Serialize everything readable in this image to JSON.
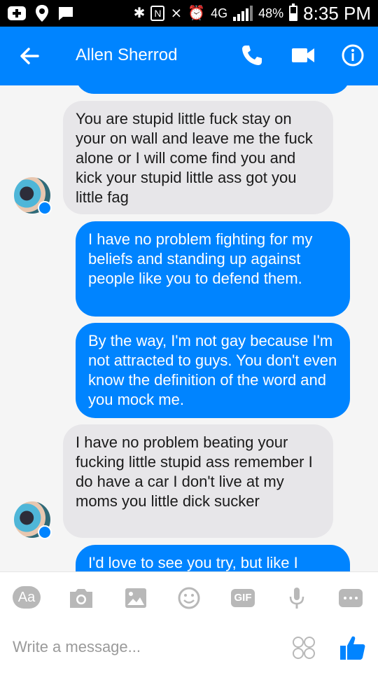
{
  "status_bar": {
    "battery_percent": "48%",
    "battery_level": 0.48,
    "time": "8:35 PM",
    "network_label": "4G",
    "left_icons": [
      "add-icon",
      "location-icon",
      "chat-icon"
    ],
    "right_icons": [
      "bluetooth-icon",
      "nfc-icon",
      "mute-icon",
      "alarm-icon",
      "network-icon",
      "signal-icon",
      "battery-icon"
    ]
  },
  "header": {
    "contact_name": "Allen Sherrod",
    "icons": [
      "back-arrow-icon",
      "phone-icon",
      "video-camera-icon",
      "info-icon"
    ],
    "color": "#0084ff"
  },
  "messages": [
    {
      "direction": "incoming",
      "text": "You are stupid little fuck stay on your on wall and leave me the fuck alone or I will come find you and kick your stupid little ass got you little fag"
    },
    {
      "direction": "outgoing",
      "text": "I have no problem fighting for my beliefs and standing up against people like you to defend them."
    },
    {
      "direction": "outgoing",
      "text": "By the way, I'm not gay because I'm not attracted to guys. You don't even know the definition of the word and you mock me."
    },
    {
      "direction": "incoming",
      "text": "I have no problem beating your fucking little stupid ass remember I do have a car I don't live at my moms you little dick sucker"
    },
    {
      "direction": "outgoing",
      "text": "I'd love to see you try, but like I"
    }
  ],
  "composer": {
    "text_style_label": "Aa",
    "gif_label": "GIF",
    "placeholder": "Write a message...",
    "tool_icons": [
      "camera-icon",
      "image-icon",
      "emoji-icon",
      "microphone-icon",
      "more-icon"
    ]
  },
  "colors": {
    "accent": "#0084ff",
    "incoming_bubble": "#e7e6e9",
    "chat_background": "#f5f5f5",
    "status_bar": "#000000"
  }
}
